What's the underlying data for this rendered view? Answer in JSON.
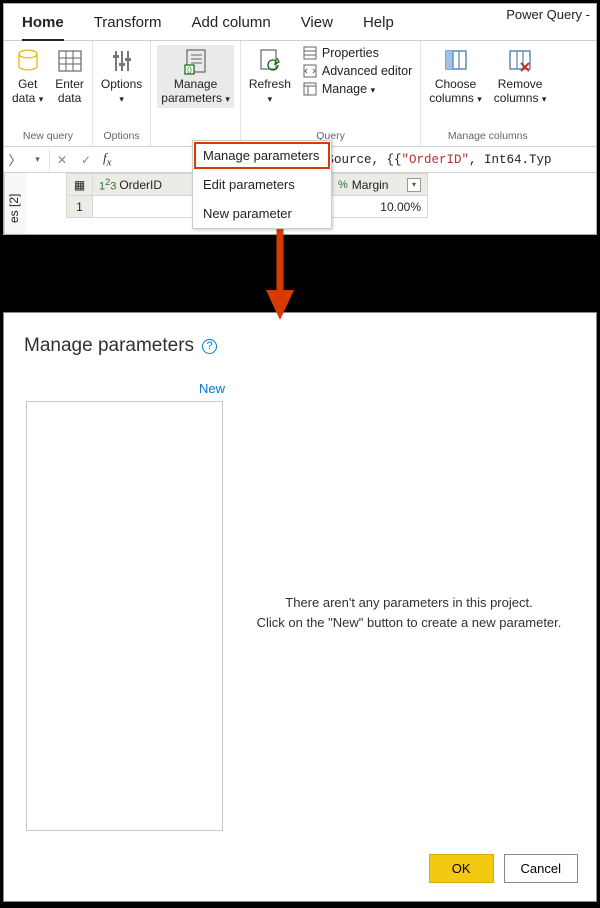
{
  "window_title": "Power Query -",
  "tabs": {
    "home": "Home",
    "transform": "Transform",
    "addcol": "Add column",
    "view": "View",
    "help": "Help"
  },
  "ribbon": {
    "new_query": {
      "get_data": "Get\ndata",
      "enter_data": "Enter\ndata",
      "caption": "New query"
    },
    "options": {
      "options": "Options",
      "caption": "Options"
    },
    "params": {
      "manage": "Manage\nparameters",
      "caption": ""
    },
    "query": {
      "refresh": "Refresh",
      "properties": "Properties",
      "adv": "Advanced editor",
      "manage": "Manage",
      "caption": "Query"
    },
    "cols": {
      "choose": "Choose\ncolumns",
      "remove": "Remove\ncolumns",
      "caption": "Manage columns"
    }
  },
  "menu": {
    "manage": "Manage parameters",
    "edit": "Edit parameters",
    "new": "New parameter"
  },
  "sidebar": "es [2]",
  "formula": {
    "prefix": "mnTypes(Source, {{",
    "str": "\"OrderID\"",
    "suffix": ", Int64.Typ"
  },
  "columns": {
    "orderid": "OrderID",
    "margin": "Margin"
  },
  "rows": [
    {
      "n": "1",
      "margin": "10.00%"
    }
  ],
  "dialog": {
    "title": "Manage parameters",
    "new": "New",
    "empty1": "There aren't any parameters in this project.",
    "empty2": "Click on the \"New\" button to create a new parameter.",
    "ok": "OK",
    "cancel": "Cancel"
  }
}
